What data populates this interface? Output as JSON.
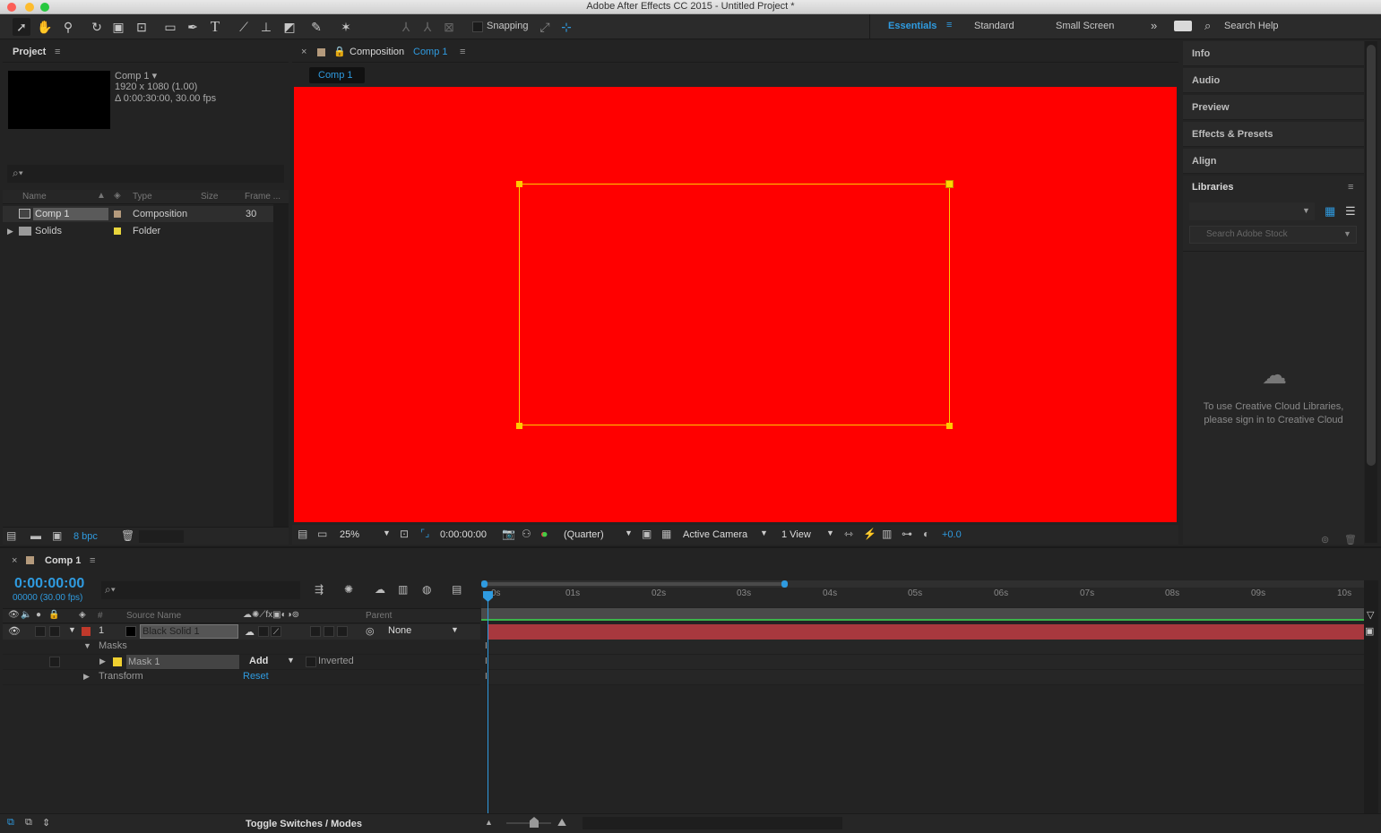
{
  "window": {
    "title": "Adobe After Effects CC 2015 - Untitled Project *"
  },
  "toolbar": {
    "snapping_label": "Snapping",
    "workspaces": [
      "Essentials",
      "Standard",
      "Small Screen"
    ],
    "search_help": "Search Help"
  },
  "project": {
    "title": "Project",
    "comp_name": "Comp 1 ▾",
    "comp_size": "1920 x 1080 (1.00)",
    "comp_duration": "Δ 0:00:30:00, 30.00 fps",
    "columns": {
      "name": "Name",
      "type": "Type",
      "size": "Size",
      "frame": "Frame ..."
    },
    "items": [
      {
        "name": "Comp 1",
        "type": "Composition",
        "frame": "30"
      },
      {
        "name": "Solids",
        "type": "Folder",
        "frame": ""
      }
    ],
    "bpc": "8 bpc"
  },
  "composition": {
    "panel_prefix": "Composition",
    "panel_name": "Comp 1",
    "tab": "Comp 1",
    "zoom": "25%",
    "timecode": "0:00:00:00",
    "resolution": "(Quarter)",
    "camera": "Active Camera",
    "views": "1 View",
    "exposure": "+0.0",
    "bg_color": "#ff0000",
    "mask_color": "#ffc800"
  },
  "right_panels": {
    "items": [
      "Info",
      "Audio",
      "Preview",
      "Effects & Presets",
      "Align"
    ],
    "libraries_title": "Libraries",
    "stock_placeholder": "Search Adobe Stock",
    "signin_line1": "To use Creative Cloud Libraries,",
    "signin_line2": "please sign in to Creative Cloud"
  },
  "timeline": {
    "tab": "Comp 1",
    "timecode": "0:00:00:00",
    "frames": "00000 (30.00 fps)",
    "columns": {
      "num": "#",
      "source": "Source Name",
      "parent": "Parent"
    },
    "layer": {
      "num": "1",
      "name": "Black Solid 1",
      "parent": "None"
    },
    "masks_label": "Masks",
    "mask": {
      "name": "Mask 1",
      "mode": "Add",
      "inverted": "Inverted"
    },
    "transform_label": "Transform",
    "reset_label": "Reset",
    "ticks": [
      "0s",
      "01s",
      "02s",
      "03s",
      "04s",
      "05s",
      "06s",
      "07s",
      "08s",
      "09s",
      "10s"
    ],
    "toggle_label": "Toggle Switches / Modes",
    "layer_bar_color": "#a8383e"
  }
}
